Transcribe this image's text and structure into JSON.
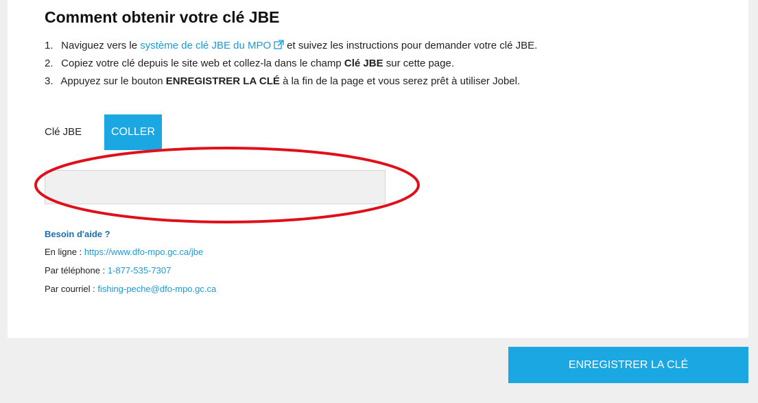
{
  "page": {
    "title": "Comment obtenir votre clé JBE"
  },
  "steps": [
    {
      "num": "1.",
      "before": "Naviguez vers le",
      "link": "système de clé JBE du MPO",
      "after": "et suivez les instructions pour demander votre clé JBE."
    },
    {
      "num": "2.",
      "before": "Copiez votre clé depuis le site web et collez-la dans le champ",
      "bold": "Clé JBE",
      "after": "sur cette page."
    },
    {
      "num": "3.",
      "before": "Appuyez sur le bouton",
      "bold": "ENREGISTRER LA CLÉ",
      "after": "à la fin de la page et vous serez prêt à utiliser Jobel."
    }
  ],
  "key_field": {
    "label": "Clé JBE",
    "paste_label": "COLLER",
    "value": ""
  },
  "help": {
    "title": "Besoin d'aide ?",
    "online_label": "En ligne :",
    "online_link": "https://www.dfo-mpo.gc.ca/jbe",
    "phone_label": "Par téléphone :",
    "phone_link": "1-877-535-7307",
    "email_label": "Par courriel :",
    "email_link": "fishing-peche@dfo-mpo.gc.ca"
  },
  "footer": {
    "save_label": "ENREGISTRER LA CLÉ"
  },
  "colors": {
    "accent": "#1aa7e2",
    "link": "#1a9ad6",
    "annotation": "#e0101a"
  },
  "icons": {
    "external_link": "external-link-icon"
  }
}
